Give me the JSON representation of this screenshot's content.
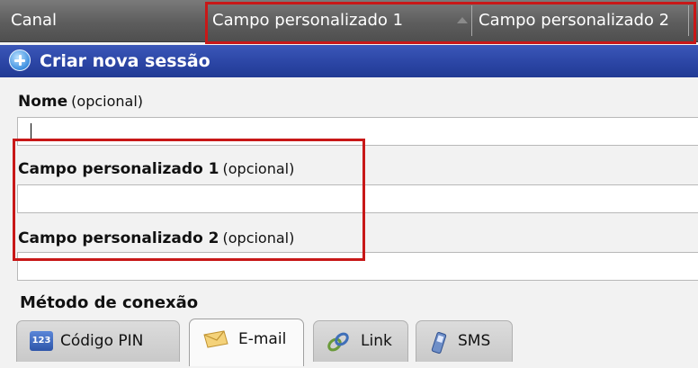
{
  "columns": {
    "channel": "Canal",
    "custom1": "Campo personalizado 1",
    "custom2": "Campo personalizado 2"
  },
  "header": {
    "title": "Criar nova sessão",
    "icon": "plus-circle-icon"
  },
  "form": {
    "name_label": "Nome",
    "name_optional": "(opcional)",
    "name_value": "",
    "custom1_label": "Campo personalizado 1",
    "custom1_optional": "(opcional)",
    "custom1_value": "",
    "custom2_label": "Campo personalizado 2",
    "custom2_optional": "(opcional)",
    "custom2_value": ""
  },
  "connection": {
    "label": "Método de conexão",
    "tabs": [
      {
        "label": "Código PIN",
        "icon": "pin-code-icon",
        "active": false
      },
      {
        "label": "E-mail",
        "icon": "envelope-icon",
        "active": true
      },
      {
        "label": "Link",
        "icon": "link-icon",
        "active": false
      },
      {
        "label": "SMS",
        "icon": "mobile-phone-icon",
        "active": false
      }
    ]
  },
  "pin_icon_text": "123",
  "colors": {
    "title_bar": "#2a44a3",
    "highlight": "#c81818",
    "column_bar": "#5d5d5d"
  }
}
